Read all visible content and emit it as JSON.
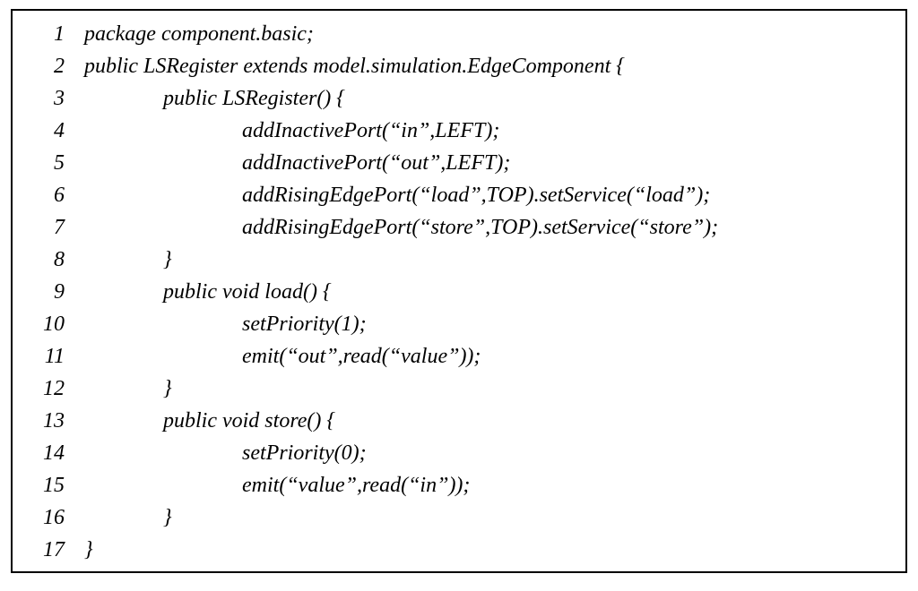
{
  "code": {
    "lines": [
      {
        "n": "1",
        "indent": 0,
        "text": "package component.basic;"
      },
      {
        "n": "2",
        "indent": 0,
        "text": "public LSRegister extends model.simulation.EdgeComponent {"
      },
      {
        "n": "3",
        "indent": 1,
        "text": "public LSRegister() {"
      },
      {
        "n": "4",
        "indent": 2,
        "text": "addInactivePort(“in”,LEFT);"
      },
      {
        "n": "5",
        "indent": 2,
        "text": "addInactivePort(“out”,LEFT);"
      },
      {
        "n": "6",
        "indent": 2,
        "text": "addRisingEdgePort(“load”,TOP).setService(“load”);"
      },
      {
        "n": "7",
        "indent": 2,
        "text": "addRisingEdgePort(“store”,TOP).setService(“store”);"
      },
      {
        "n": "8",
        "indent": 1,
        "text": "}"
      },
      {
        "n": "9",
        "indent": 1,
        "text": "public void load() {"
      },
      {
        "n": "10",
        "indent": 2,
        "text": "setPriority(1);"
      },
      {
        "n": "11",
        "indent": 2,
        "text": "emit(“out”,read(“value”));"
      },
      {
        "n": "12",
        "indent": 1,
        "text": "}"
      },
      {
        "n": "13",
        "indent": 1,
        "text": "public void store() {"
      },
      {
        "n": "14",
        "indent": 2,
        "text": "setPriority(0);"
      },
      {
        "n": "15",
        "indent": 2,
        "text": "emit(“value”,read(“in”));"
      },
      {
        "n": "16",
        "indent": 1,
        "text": "}"
      },
      {
        "n": "17",
        "indent": 0,
        "text": "}"
      }
    ]
  }
}
